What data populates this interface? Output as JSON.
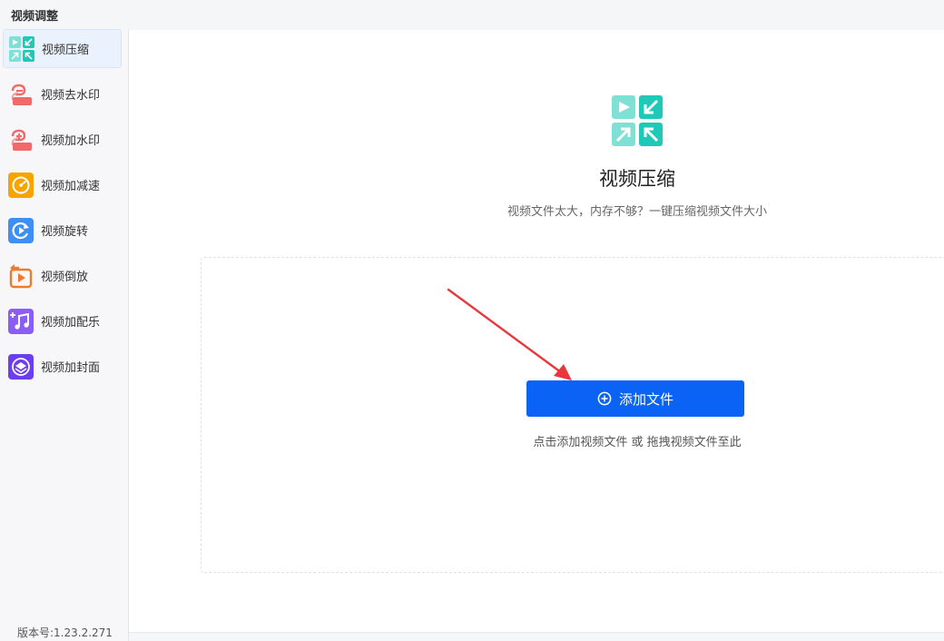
{
  "window": {
    "title": "视频调整"
  },
  "sidebar": {
    "items": [
      {
        "label": "视频压缩",
        "icon": "compress-icon",
        "active": true
      },
      {
        "label": "视频去水印",
        "icon": "remove-watermark-icon",
        "active": false
      },
      {
        "label": "视频加水印",
        "icon": "add-watermark-icon",
        "active": false
      },
      {
        "label": "视频加减速",
        "icon": "speed-icon",
        "active": false
      },
      {
        "label": "视频旋转",
        "icon": "rotate-icon",
        "active": false
      },
      {
        "label": "视频倒放",
        "icon": "reverse-icon",
        "active": false
      },
      {
        "label": "视频加配乐",
        "icon": "music-icon",
        "active": false
      },
      {
        "label": "视频加封面",
        "icon": "cover-icon",
        "active": false
      }
    ],
    "version": "版本号:1.23.2.271"
  },
  "main": {
    "title": "视频压缩",
    "subtitle": "视频文件太大，内存不够？一键压缩视频文件大小",
    "add_button_label": "添加文件",
    "hint": "点击添加视频文件 或 拖拽视频文件至此"
  },
  "colors": {
    "accent": "#0a63f5",
    "compress_teal": "#1ec9b7",
    "watermark_red": "#f06a6a",
    "speed_orange": "#f7a400",
    "rotate_blue": "#3d8ef5",
    "reverse_orange": "#f07a2c",
    "music_purple": "#8b5cf6",
    "cover_purple": "#6d3ef0",
    "annotation_red": "#e8383d"
  }
}
